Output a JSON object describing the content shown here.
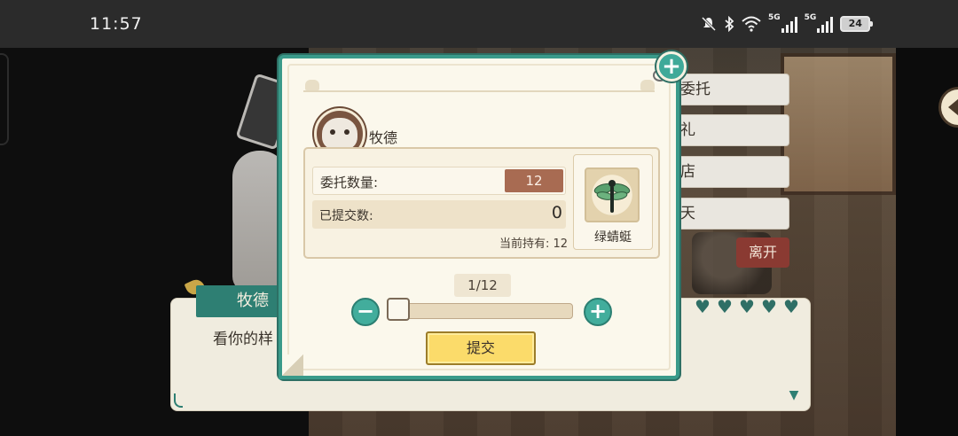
{
  "status_bar": {
    "time": "11:57",
    "network_label_1": "5G",
    "network_label_2": "5G",
    "battery": "24"
  },
  "background": {
    "menu_items": [
      "委托",
      "礼",
      "店",
      "天"
    ],
    "leave_button": "离开",
    "dialog": {
      "speaker": "牧德",
      "text": "看你的样",
      "hearts": 5
    }
  },
  "modal": {
    "npc_name": "牧德",
    "commission_label": "委托数量:",
    "commission_value": "12",
    "submitted_label": "已提交数:",
    "submitted_value": "0",
    "held_text": "当前持有: 12",
    "item_name": "绿蜻蜓",
    "item_icon": "dragonfly-icon",
    "quantity_display": "1/12",
    "quantity": {
      "current": 1,
      "max": 12
    },
    "submit_label": "提交"
  },
  "colors": {
    "modal_border": "#3a9a8a",
    "accent_teal": "#42ad9c",
    "submit_yellow": "#fbdb6a",
    "commission_badge": "#a86b52"
  }
}
